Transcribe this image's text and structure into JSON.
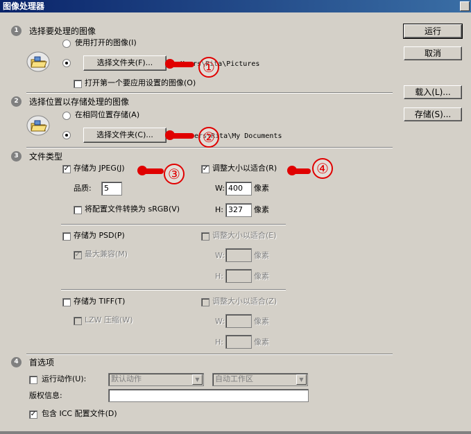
{
  "window": {
    "title": "图像处理器"
  },
  "buttons": {
    "run": "运行",
    "cancel": "取消",
    "load": "载入(L)...",
    "save": "存储(S)..."
  },
  "section1": {
    "num": "1",
    "title": "选择要处理的图像",
    "radio_open": "使用打开的图像(I)",
    "folder_button": "选择文件夹(F)...",
    "path": "Users\\Rita\\Pictures",
    "open_first": "打开第一个要应用设置的图像(O)"
  },
  "section2": {
    "num": "2",
    "title": "选择位置以存储处理的图像",
    "radio_same": "在相同位置存储(A)",
    "folder_button": "选择文件夹(C)...",
    "path": "Users\\Rita\\My Documents"
  },
  "section3": {
    "num": "3",
    "title": "文件类型",
    "jpeg": "存储为 JPEG(J)",
    "jpeg_resize": "调整大小以适合(R)",
    "quality_label": "品质:",
    "quality": "5",
    "w_label": "W:",
    "h_label": "H:",
    "w_value": "400",
    "h_value": "327",
    "px": "像素",
    "srgb": "将配置文件转换为 sRGB(V)",
    "psd": "存储为 PSD(P)",
    "psd_resize": "调整大小以适合(E)",
    "max_compat": "最大兼容(M)",
    "tiff": "存储为 TIFF(T)",
    "tiff_resize": "调整大小以适合(Z)",
    "lzw": "LZW 压缩(W)",
    "check_mark": "✓"
  },
  "section4": {
    "num": "4",
    "title": "首选项",
    "run_action": "运行动作(U):",
    "action_value": "默认动作",
    "action_set": "自动工作区",
    "copyright": "版权信息:",
    "icc": "包含 ICC 配置文件(D)"
  },
  "annotations": [
    "①",
    "②",
    "③",
    "④"
  ],
  "colors": {
    "title_start": "#0a246a",
    "title_end": "#3a6ea5",
    "annotation": "#e00000",
    "face": "#d4d0c8"
  }
}
